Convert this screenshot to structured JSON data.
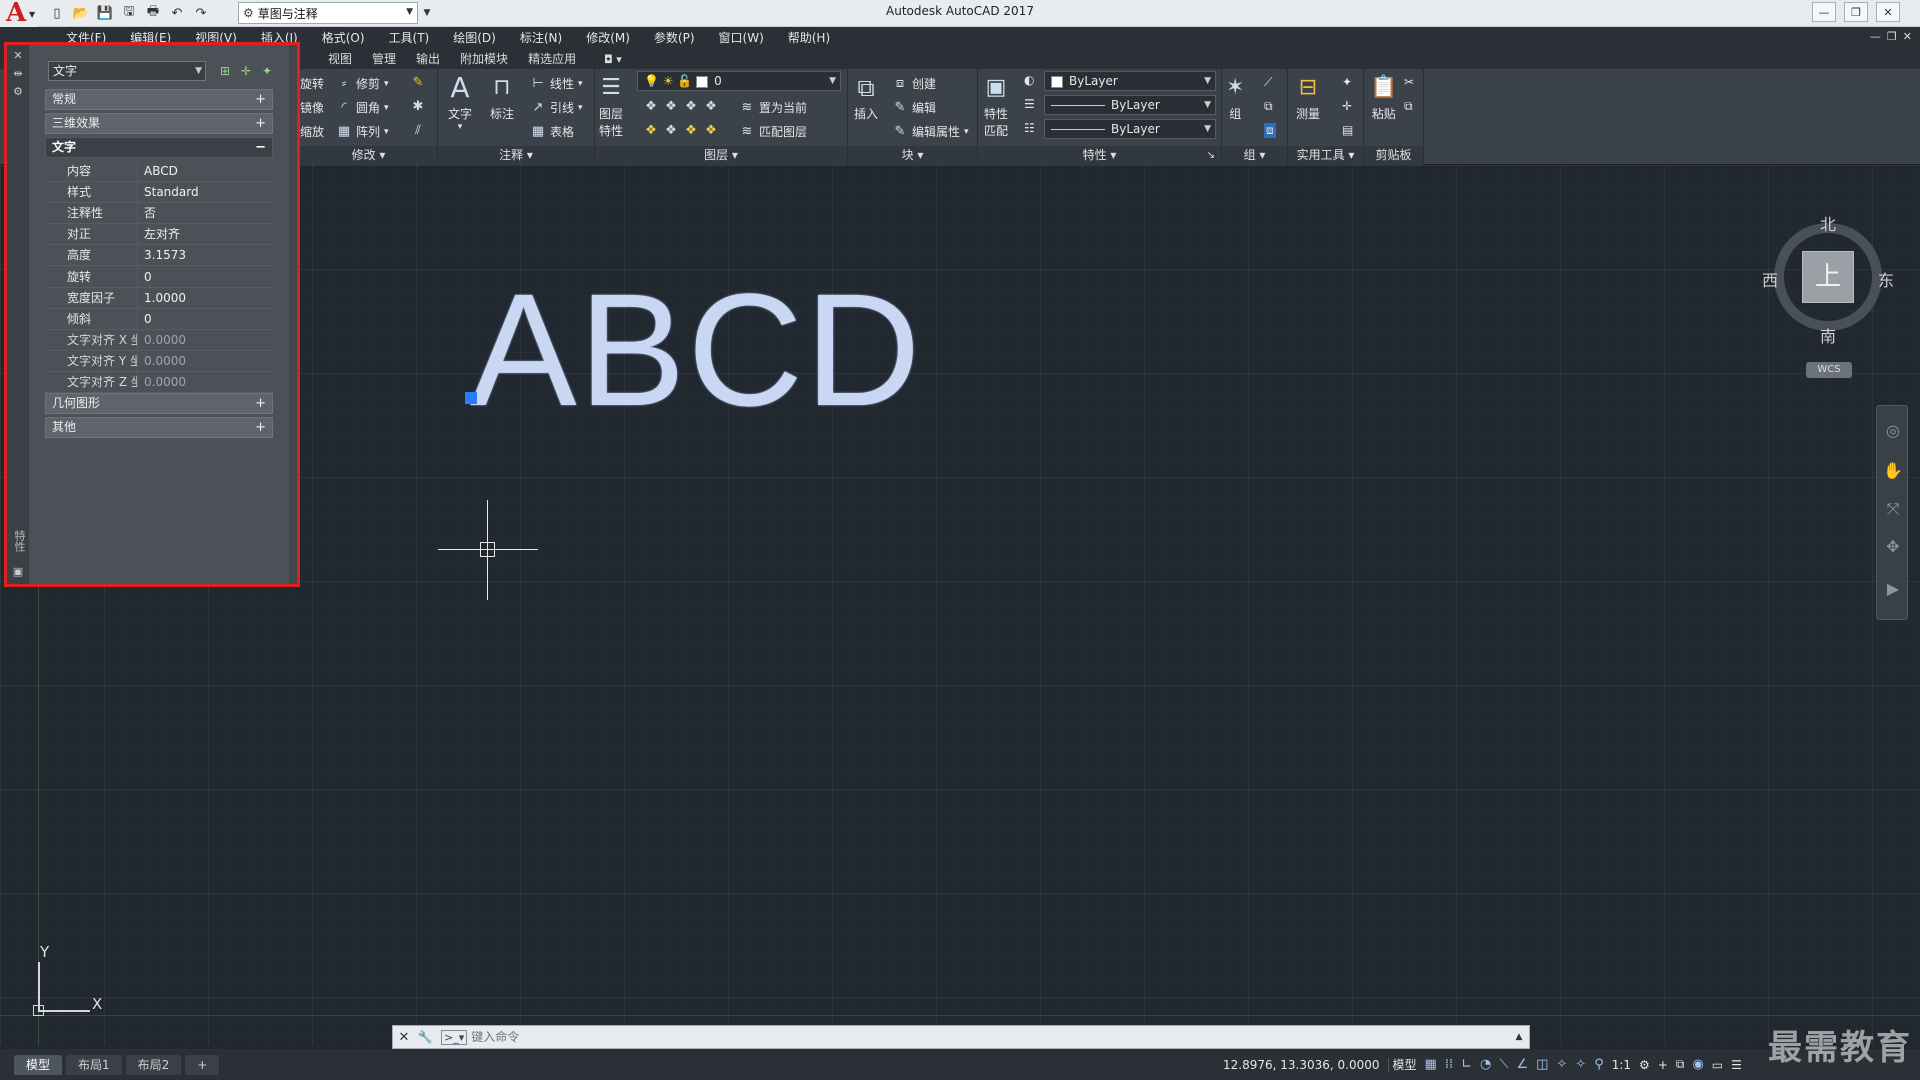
{
  "window": {
    "title": "Autodesk AutoCAD 2017",
    "workspace": "草图与注释",
    "controls": [
      "—",
      "❐",
      "✕"
    ]
  },
  "menubar": {
    "items": [
      "文件(F)",
      "编辑(E)",
      "视图(V)",
      "插入(I)",
      "格式(O)",
      "工具(T)",
      "绘图(D)",
      "标注(N)",
      "修改(M)",
      "参数(P)",
      "窗口(W)",
      "帮助(H)"
    ]
  },
  "ribbon_tabs": {
    "items": [
      "视图",
      "管理",
      "输出",
      "附加模块",
      "精选应用"
    ]
  },
  "ribbon": {
    "modify": {
      "title": "修改",
      "rotate": "旋转",
      "trim": "修剪",
      "mirror": "镜像",
      "fillet": "圆角",
      "scale": "缩放",
      "array": "阵列"
    },
    "annotation": {
      "title": "注释",
      "text": "文字",
      "dimension": "标注",
      "linear": "线性",
      "leader": "引线",
      "table": "表格"
    },
    "layers": {
      "title": "图层",
      "layer_props": "图层\n特性",
      "layer_props_line1": "图层",
      "layer_props_line2": "特性",
      "current_layer": "0",
      "set_current": "置为当前",
      "match_layer": "匹配图层"
    },
    "block": {
      "title": "块",
      "insert": "插入",
      "create": "创建",
      "edit": "编辑",
      "edit_attr": "编辑属性"
    },
    "properties": {
      "title": "特性",
      "match_line1": "特性",
      "match_line2": "匹配",
      "color": "ByLayer",
      "linetype": "ByLayer",
      "lineweight": "ByLayer"
    },
    "groups": {
      "title": "组",
      "group": "组"
    },
    "utilities": {
      "title": "实用工具",
      "measure": "测量"
    },
    "clipboard": {
      "title": "剪贴板",
      "paste": "粘贴"
    }
  },
  "canvas": {
    "text": "ABCD",
    "ucs_y": "Y",
    "ucs_x": "X"
  },
  "viewcube": {
    "north": "北",
    "south": "南",
    "east": "东",
    "west": "西",
    "face": "上",
    "wcs": "WCS"
  },
  "properties_palette": {
    "object_type": "文字",
    "categories": {
      "general": "常规",
      "effects3d": "三维效果",
      "text": "文字",
      "geometry": "几何图形",
      "misc": "其他"
    },
    "rows": [
      {
        "key": "内容",
        "value": "ABCD"
      },
      {
        "key": "样式",
        "value": "Standard"
      },
      {
        "key": "注释性",
        "value": "否"
      },
      {
        "key": "对正",
        "value": "左对齐"
      },
      {
        "key": "高度",
        "value": "3.1573"
      },
      {
        "key": "旋转",
        "value": "0"
      },
      {
        "key": "宽度因子",
        "value": "1.0000"
      },
      {
        "key": "倾斜",
        "value": "0"
      },
      {
        "key": "文字对齐 X 坐...",
        "value": "0.0000"
      },
      {
        "key": "文字对齐 Y 坐...",
        "value": "0.0000"
      },
      {
        "key": "文字对齐 Z 坐...",
        "value": "0.0000"
      }
    ],
    "side_label": "特性"
  },
  "command_line": {
    "placeholder": "键入命令"
  },
  "layout_tabs": [
    "模型",
    "布局1",
    "布局2",
    "+"
  ],
  "statusbar": {
    "coords": "12.8976, 13.3036, 0.0000",
    "model": "模型",
    "scale": "1:1"
  },
  "watermark": "最需教育"
}
